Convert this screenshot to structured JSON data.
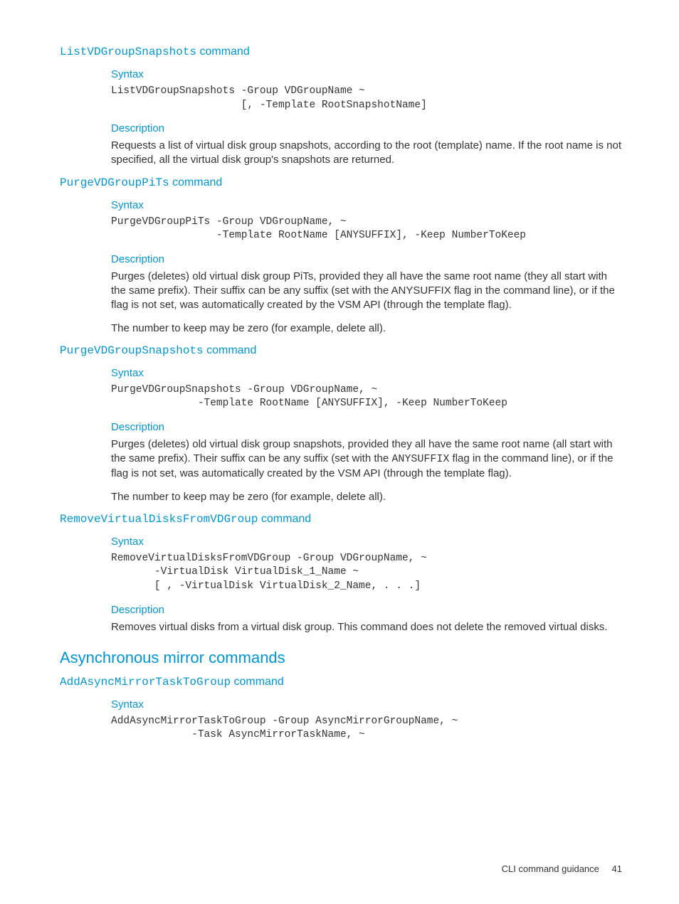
{
  "s1": {
    "heading_code": "ListVDGroupSnapshots",
    "heading_tail": " command",
    "syntax_label": "Syntax",
    "code": "ListVDGroupSnapshots -Group VDGroupName ~\n                     [, -Template RootSnapshotName]",
    "desc_label": "Description",
    "desc": "Requests a list of virtual disk group snapshots, according to the root (template) name. If the root name is not specified, all the virtual disk group's snapshots are returned."
  },
  "s2": {
    "heading_code": "PurgeVDGroupPiTs",
    "heading_tail": " command",
    "syntax_label": "Syntax",
    "code": "PurgeVDGroupPiTs -Group VDGroupName, ~\n                 -Template RootName [ANYSUFFIX], -Keep NumberToKeep",
    "desc_label": "Description",
    "p1": "Purges (deletes) old virtual disk group PiTs, provided they all have the same root name (they all start with the same prefix). Their suffix can be any suffix (set with the ANYSUFFIX flag in the command line), or if the flag is not set, was automatically created by the VSM API (through the template flag).",
    "p2": "The number to keep may be zero (for example, delete all)."
  },
  "s3": {
    "heading_code": "PurgeVDGroupSnapshots",
    "heading_tail": " command",
    "syntax_label": "Syntax",
    "code": "PurgeVDGroupSnapshots -Group VDGroupName, ~\n              -Template RootName [ANYSUFFIX], -Keep NumberToKeep",
    "desc_label": "Description",
    "p1a": "Purges (deletes) old virtual disk group snapshots, provided they all have the same root name (all start with the same prefix). Their suffix can be any suffix (set with the ",
    "p1_code": "ANYSUFFIX",
    "p1b": " flag in the command line), or if the flag is not set, was automatically created by the VSM API (through the template flag).",
    "p2": "The number to keep may be zero (for example, delete all)."
  },
  "s4": {
    "heading_code": "RemoveVirtualDisksFromVDGroup",
    "heading_tail": " command",
    "syntax_label": "Syntax",
    "code": "RemoveVirtualDisksFromVDGroup -Group VDGroupName, ~\n       -VirtualDisk VirtualDisk_1_Name ~\n       [ , -VirtualDisk VirtualDisk_2_Name, . . .]",
    "desc_label": "Description",
    "desc": "Removes virtual disks from a virtual disk group. This command does not delete the removed virtual disks."
  },
  "section": {
    "title": "Asynchronous mirror commands"
  },
  "s5": {
    "heading_code": "AddAsyncMirrorTaskToGroup",
    "heading_tail": " command",
    "syntax_label": "Syntax",
    "code": "AddAsyncMirrorTaskToGroup -Group AsyncMirrorGroupName, ~\n             -Task AsyncMirrorTaskName, ~"
  },
  "footer": {
    "text": "CLI command guidance",
    "page": "41"
  }
}
